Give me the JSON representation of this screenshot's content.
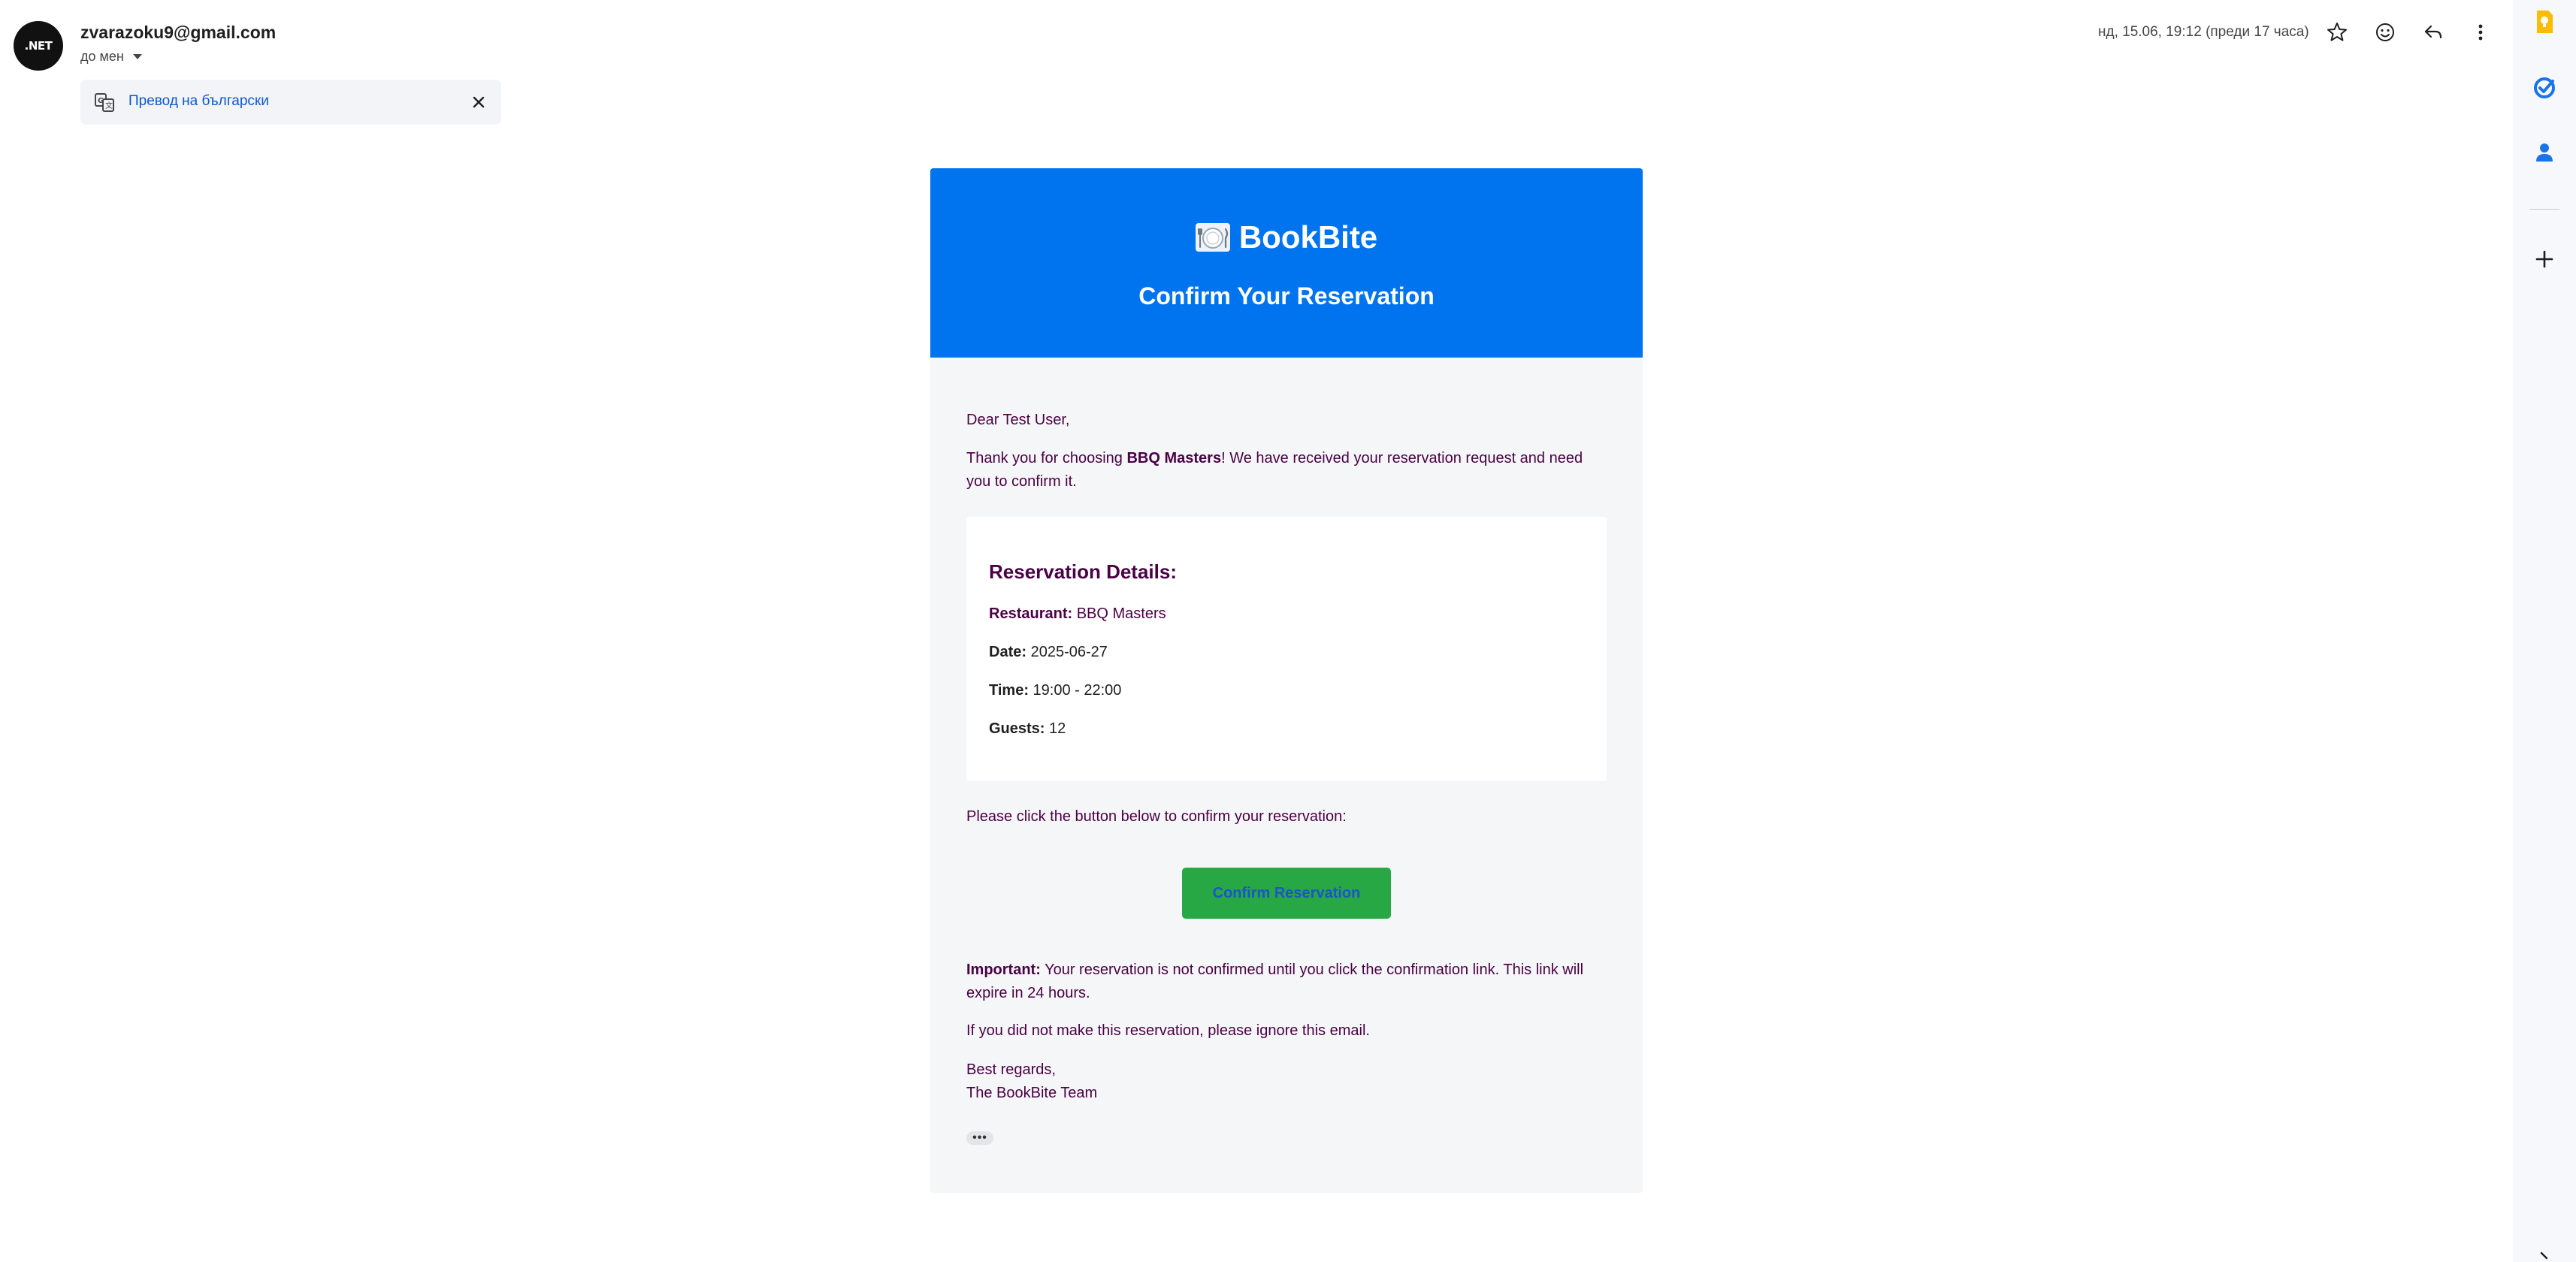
{
  "header": {
    "avatar_text": ".NET",
    "sender_email": "zvarazoku9@gmail.com",
    "to_label": "до мен",
    "date": "нд, 15.06, 19:12 (преди 17 часа)"
  },
  "translate_bar": {
    "link_text": "Превод на български"
  },
  "icons": {
    "star": "star-icon",
    "emoji": "emoji-icon",
    "reply": "reply-icon",
    "more": "more-vert-icon",
    "translate": "translate-icon",
    "close": "close-icon",
    "keep": "keep-icon",
    "tasks": "tasks-icon",
    "contacts": "contacts-icon",
    "add": "add-icon",
    "brand": "plate-cutlery-icon"
  },
  "email": {
    "brand_name": "BookBite",
    "header_title": "Confirm Your Reservation",
    "greeting": "Dear Test User,",
    "intro_prefix": "Thank you for choosing ",
    "intro_restaurant": "BBQ Masters",
    "intro_suffix_line1": "! We have received your reservation request and need",
    "intro_suffix_line2": "you to confirm it.",
    "details": {
      "title": "Reservation Details:",
      "restaurant_label": "Restaurant:",
      "restaurant_value": "BBQ Masters",
      "date_label": "Date:",
      "date_value": "2025-06-27",
      "time_label": "Time:",
      "time_value": "19:00 - 22:00",
      "guests_label": "Guests:",
      "guests_value": "12"
    },
    "click_prompt": "Please click the button below to confirm your reservation:",
    "confirm_button": "Confirm Reservation",
    "important_label": "Important:",
    "important_line1": " Your reservation is not confirmed until you click the confirmation link. This link will",
    "important_line2": "expire in 24 hours.",
    "ignore_text": "If you did not make this reservation, please ignore this email.",
    "regards": "Best regards,",
    "signature": "The BookBite Team",
    "more_dots": "•••"
  },
  "colors": {
    "header_blue": "#0073ee",
    "button_green": "#28a745",
    "body_text": "#4a0044",
    "link_blue": "#0b57d0"
  }
}
